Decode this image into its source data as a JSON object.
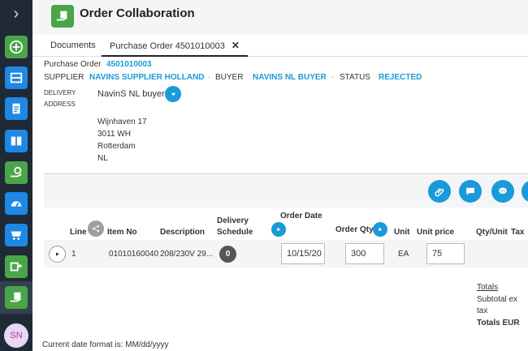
{
  "header": {
    "title": "Order Collaboration"
  },
  "tabs": [
    {
      "label": "Documents"
    },
    {
      "label": "Purchase Order 4501010003",
      "close": "✕"
    }
  ],
  "order": {
    "po_label": "Purchase Order",
    "po_number": "4501010003",
    "supplier_label": "SUPPLIER",
    "supplier": "NAVINS SUPPLIER HOLLAND",
    "buyer_label": "BUYER",
    "buyer": "NAVINS NL BUYER",
    "status_label": "STATUS",
    "status": "REJECTED",
    "delivery_label_1": "DELIVERY",
    "delivery_label_2": "ADDRESS",
    "delivery_name": "NavinS NL buyer",
    "address_lines": [
      "Wijnhaven 17",
      "3011 WH",
      "Rotterdam",
      "NL"
    ]
  },
  "table": {
    "headers": {
      "line": "Line",
      "item_no": "Item No",
      "description": "Description",
      "delivery_1": "Delivery",
      "delivery_2": "Schedule",
      "order_date": "Order Date",
      "order_qty": "Order Qty",
      "unit": "Unit",
      "unit_price": "Unit price",
      "qty_unit": "Qty/Unit",
      "tax": "Tax"
    },
    "rows": [
      {
        "line": "1",
        "item_no": "01010160040",
        "description": "208/230V 29...",
        "schedule_count": "0",
        "order_date": "10/15/20",
        "order_qty": "300",
        "unit": "EA",
        "unit_price": "75"
      }
    ]
  },
  "totals": {
    "heading": "Totals",
    "subtotal_1": "Subtotal ex",
    "subtotal_2": "tax",
    "total": "Totals EUR"
  },
  "footer": {
    "date_format": "Current date format is: MM/dd/yyyy"
  },
  "avatar": {
    "initials": "SN"
  },
  "colors": {
    "accent": "#1a9ad9",
    "sidebar": "#1f2a36",
    "green": "#4aa548"
  }
}
